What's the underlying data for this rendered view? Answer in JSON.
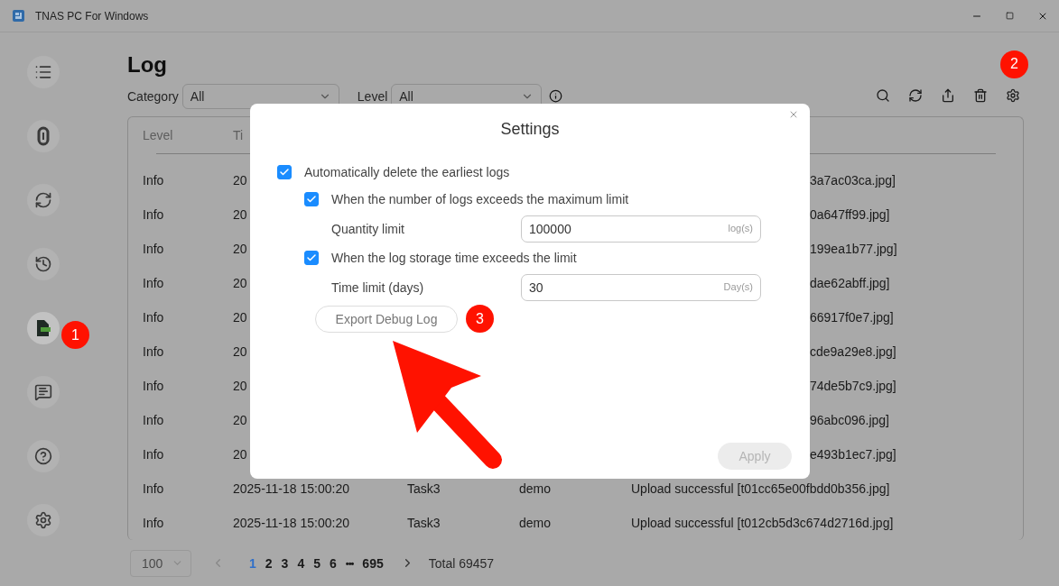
{
  "window": {
    "title": "TNAS PC For Windows"
  },
  "sidebar": {
    "items": [
      {
        "kind": "list",
        "selected": false
      },
      {
        "kind": "ring",
        "selected": false
      },
      {
        "kind": "sync",
        "selected": false
      },
      {
        "kind": "backup",
        "selected": false
      },
      {
        "kind": "log",
        "selected": true,
        "badge": "1"
      },
      {
        "kind": "message",
        "selected": false
      },
      {
        "kind": "help",
        "selected": false
      },
      {
        "kind": "settings",
        "selected": false
      }
    ]
  },
  "page": {
    "title": "Log"
  },
  "filters": [
    {
      "label": "Category",
      "value": "All"
    },
    {
      "label": "Level",
      "value": "All"
    }
  ],
  "toolbar": [
    {
      "kind": "search"
    },
    {
      "kind": "refresh"
    },
    {
      "kind": "export"
    },
    {
      "kind": "delete"
    },
    {
      "kind": "settings",
      "badge": "2"
    }
  ],
  "table": {
    "columns": [
      "Level",
      "Ti"
    ],
    "rows": [
      {
        "kind": "covered",
        "level": "Info",
        "time": "20",
        "message": "3a7ac03ca.jpg]"
      },
      {
        "kind": "covered",
        "level": "Info",
        "time": "20",
        "message": "0a647ff99.jpg]"
      },
      {
        "kind": "covered",
        "level": "Info",
        "time": "20",
        "message": "199ea1b77.jpg]"
      },
      {
        "kind": "covered",
        "level": "Info",
        "time": "20",
        "message": "dae62abff.jpg]"
      },
      {
        "kind": "covered",
        "level": "Info",
        "time": "20",
        "message": "66917f0e7.jpg]"
      },
      {
        "kind": "covered",
        "level": "Info",
        "time": "20",
        "message": "cde9a29e8.jpg]"
      },
      {
        "kind": "covered",
        "level": "Info",
        "time": "20",
        "message": "74de5b7c9.jpg]"
      },
      {
        "kind": "covered",
        "level": "Info",
        "time": "20",
        "message": "96abc096.jpg]"
      },
      {
        "kind": "covered",
        "level": "Info",
        "time": "20",
        "message": "e493b1ec7.jpg]"
      },
      {
        "kind": "full",
        "level": "Info",
        "time": "2025-11-18 15:00:20",
        "task": "Task3",
        "user": "demo",
        "message": "Upload successful [t01cc65e00fbdd0b356.jpg]"
      },
      {
        "kind": "full",
        "level": "Info",
        "time": "2025-11-18 15:00:20",
        "task": "Task3",
        "user": "demo",
        "message": "Upload successful [t012cb5d3c674d2716d.jpg]"
      }
    ]
  },
  "pagination": {
    "page_size": "100",
    "pages": [
      {
        "kind": "page",
        "label": "1",
        "selected": true
      },
      {
        "kind": "page",
        "label": "2",
        "selected": false
      },
      {
        "kind": "page",
        "label": "3",
        "selected": false
      },
      {
        "kind": "page",
        "label": "4",
        "selected": false
      },
      {
        "kind": "page",
        "label": "5",
        "selected": false
      },
      {
        "kind": "page",
        "label": "6",
        "selected": false
      },
      {
        "kind": "more",
        "label": "•••",
        "selected": false
      },
      {
        "kind": "page",
        "label": "695",
        "selected": false
      }
    ],
    "total": "Total 69457"
  },
  "dialog": {
    "title": "Settings",
    "auto_delete": {
      "label": "Automatically delete the earliest logs",
      "checked": true,
      "children": [
        {
          "label": "When the number of logs exceeds the maximum limit",
          "checked": true,
          "field": {
            "label": "Quantity limit",
            "value": "100000",
            "unit": "log(s)"
          }
        },
        {
          "label": "When the log storage time exceeds the limit",
          "checked": true,
          "field": {
            "label": "Time limit (days)",
            "value": "30",
            "unit": "Day(s)"
          }
        }
      ]
    },
    "export_button": {
      "label": "Export Debug Log",
      "badge": "3"
    },
    "apply_button": {
      "label": "Apply",
      "disabled": true
    }
  }
}
